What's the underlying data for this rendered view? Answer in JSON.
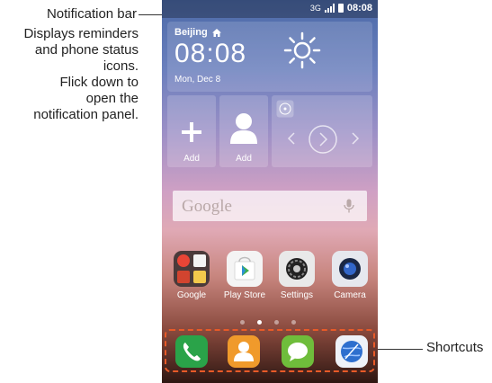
{
  "callouts": {
    "notification_title": "Notification bar",
    "notification_body": [
      "Displays reminders",
      "and phone status",
      "icons.",
      "Flick down to",
      "open the",
      "notification panel."
    ],
    "shortcuts": "Shortcuts"
  },
  "status_bar": {
    "network": "3G",
    "time": "08:08"
  },
  "weather": {
    "city": "Beijing",
    "time": "08:08",
    "date": "Mon, Dec 8"
  },
  "tiles": [
    {
      "label": "Add"
    },
    {
      "label": "Add"
    }
  ],
  "search": {
    "placeholder": "Google"
  },
  "apps": [
    {
      "label": "Google"
    },
    {
      "label": "Play Store"
    },
    {
      "label": "Settings"
    },
    {
      "label": "Camera"
    }
  ],
  "dock": [
    {
      "icon": "phone-icon"
    },
    {
      "icon": "contacts-icon"
    },
    {
      "icon": "messaging-icon"
    },
    {
      "icon": "browser-icon"
    }
  ],
  "colors": {
    "accent_dashed": "#e85a28",
    "phone_green": "#2aa349",
    "contacts_orange": "#f09a2b",
    "messaging_green": "#6fbd3b",
    "browser_blue": "#2e6fce"
  },
  "page_indicator": {
    "count": 4,
    "active_index": 1
  }
}
